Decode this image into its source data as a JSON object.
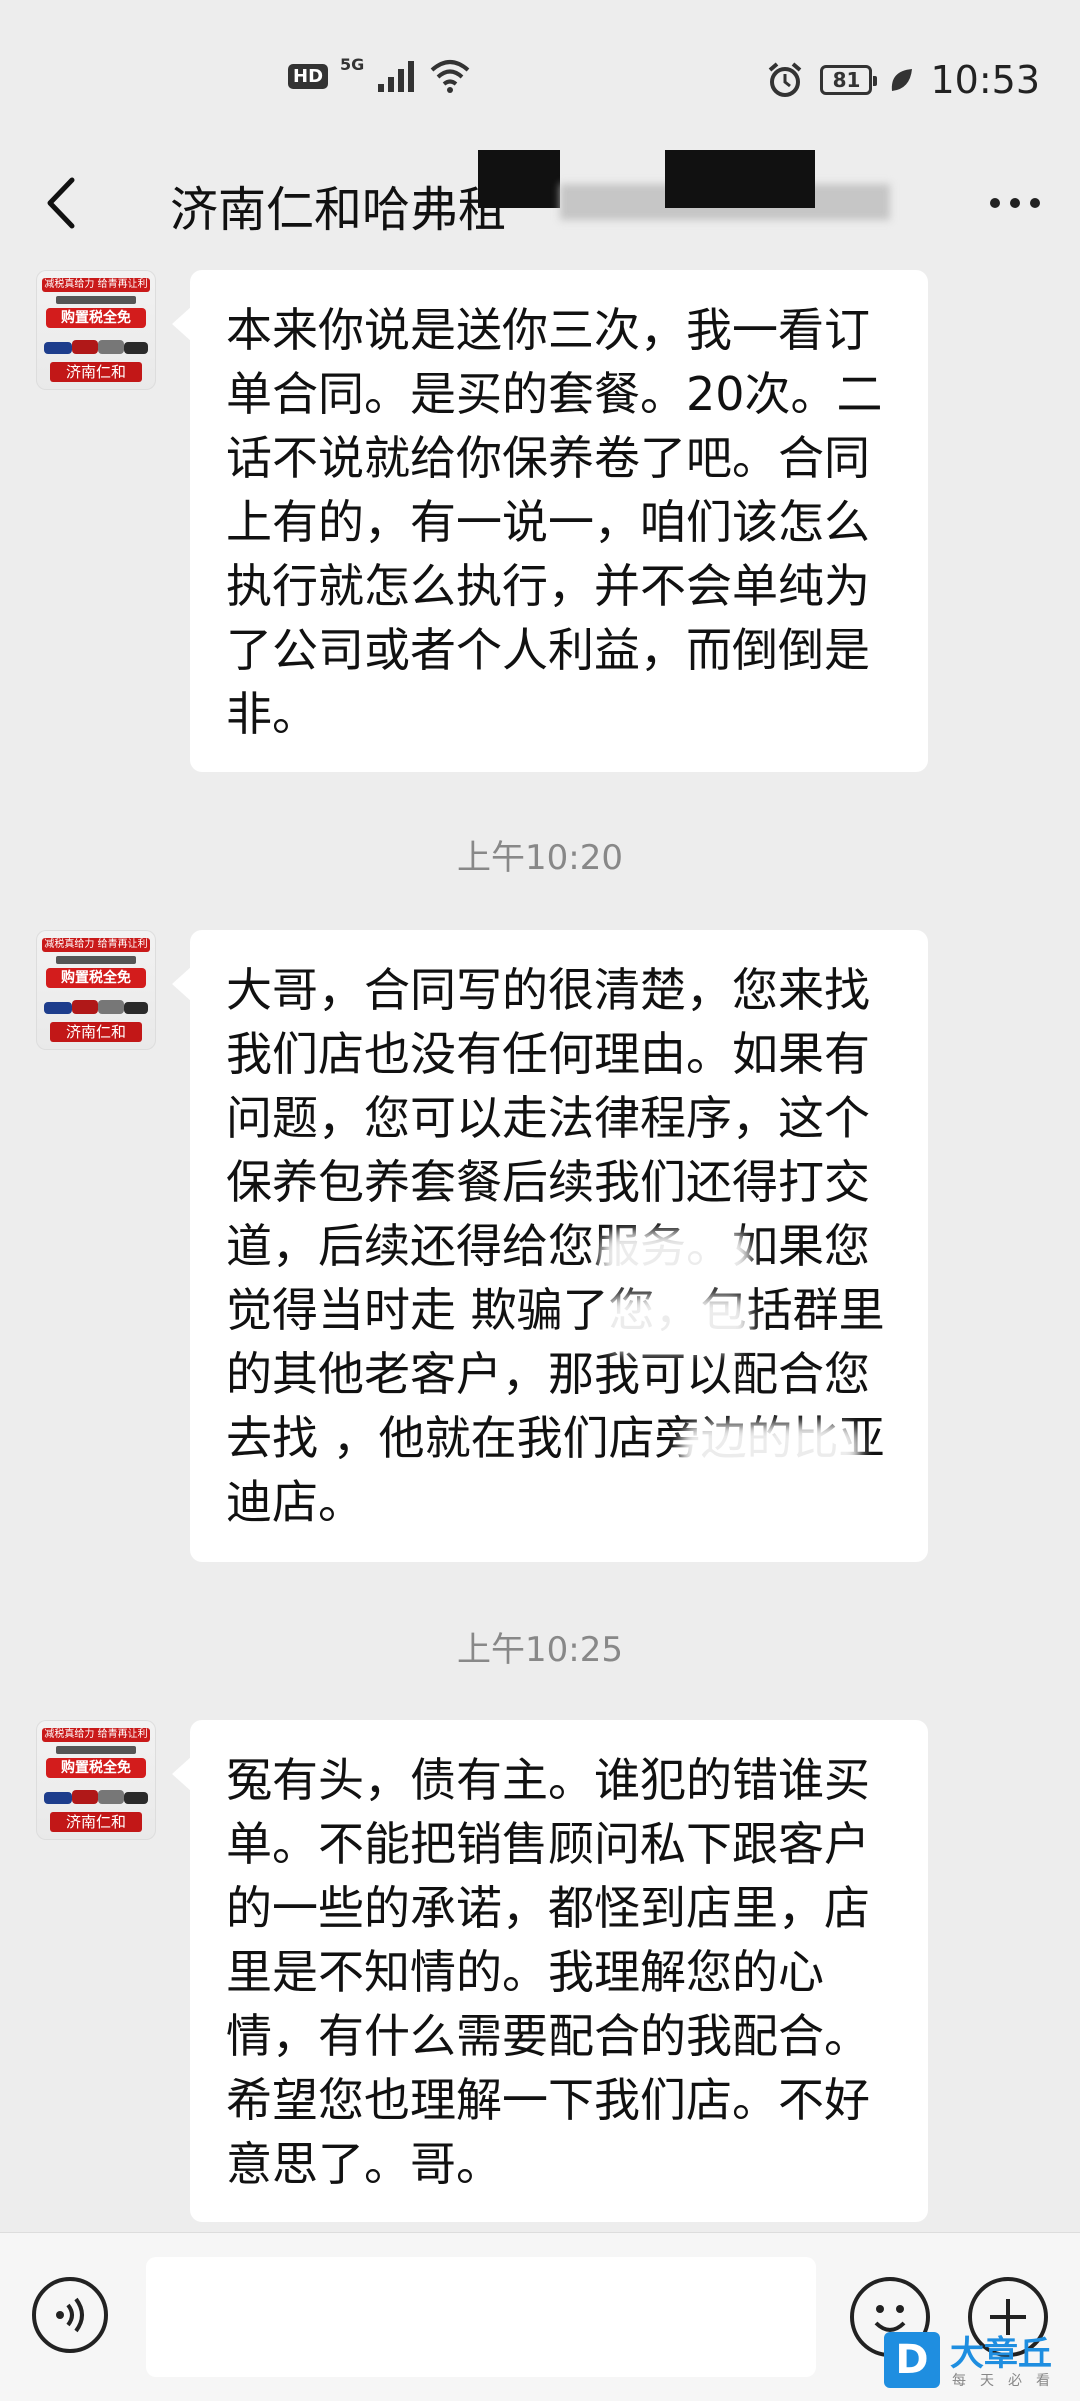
{
  "status_bar": {
    "hd": "HD",
    "network": "5G",
    "battery": "81",
    "time": "10:53"
  },
  "header": {
    "title": "济南仁和哈弗租"
  },
  "avatar": {
    "line1": "减税真给力 给青再让利",
    "line2": "购置税全免",
    "line3": "济南仁和"
  },
  "messages": [
    {
      "text": "本来你说是送你三次，我一看订单合同。是买的套餐。20次。二话不说就给你保养卷了吧。合同上有的，有一说一，咱们该怎么执行就怎么执行，并不会单纯为了公司或者个人利益，而倒倒是非。"
    },
    {
      "timestamp": "上午10:20"
    },
    {
      "text": "大哥，合同写的很清楚，您来找我们店也没有任何理由。如果有问题，您可以走法律程序，这个保养包养套餐后续我们还得打交道，后续还得给您服务。如果您觉得当时走    欺骗了您，包括群里的其他老客户，那我可以配合您去找     ，他就在我们店旁边的比亚迪店。"
    },
    {
      "timestamp": "上午10:25"
    },
    {
      "text": "冤有头，债有主。谁犯的错谁买单。不能把销售顾问私下跟客户的一些的承诺，都怪到店里，店里是不知情的。我理解您的心情，有什么需要配合的我配合。希望您也理解一下我们店。不好意思了。哥。"
    }
  ],
  "input": {
    "value": ""
  },
  "watermark": {
    "title": "大章丘",
    "subtitle": "每天必看"
  }
}
